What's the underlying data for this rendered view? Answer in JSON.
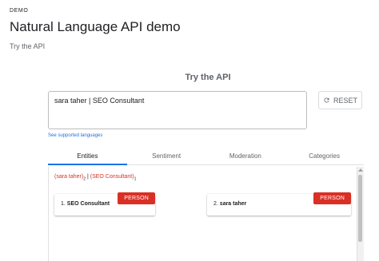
{
  "header": {
    "eyebrow": "DEMO",
    "title": "Natural Language API demo",
    "subtitle": "Try the API"
  },
  "demo": {
    "heading": "Try the API",
    "input_text": "sara taher | SEO Consultant",
    "reset_label": "RESET",
    "languages_link": "See supported languages"
  },
  "tabs": [
    {
      "label": "Entities",
      "active": true
    },
    {
      "label": "Sentiment",
      "active": false
    },
    {
      "label": "Moderation",
      "active": false
    },
    {
      "label": "Categories",
      "active": false
    }
  ],
  "annotated_text": {
    "entity_1": "sara taher",
    "entity_1_index": "2",
    "separator": "|",
    "entity_2": "SEO Consultant",
    "entity_2_index": "1"
  },
  "entities": [
    {
      "number": "1.",
      "name": "SEO Consultant",
      "type": "PERSON"
    },
    {
      "number": "2.",
      "name": "sara taher",
      "type": "PERSON"
    }
  ],
  "colors": {
    "accent": "#1a73e8",
    "entity_red": "#d93025",
    "muted_text": "#5f6368"
  },
  "icons": {
    "reset": "refresh-icon"
  }
}
